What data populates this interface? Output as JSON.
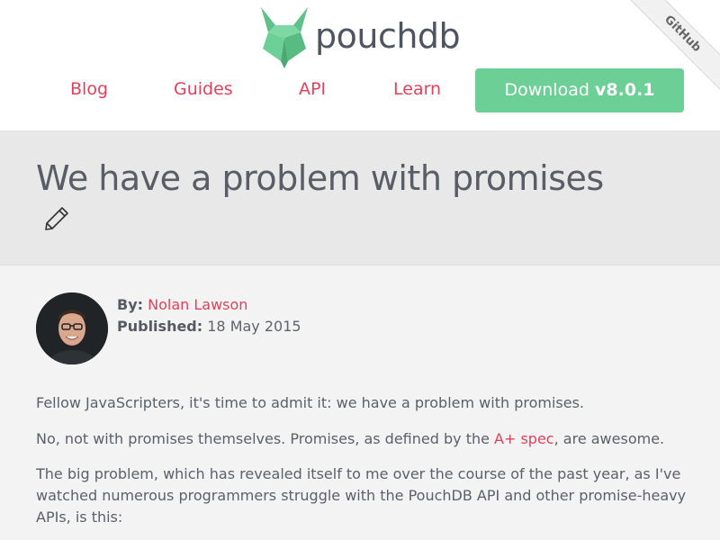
{
  "header": {
    "logo_text": "pouchdb",
    "nav": [
      "Blog",
      "Guides",
      "API",
      "Learn"
    ],
    "download": {
      "label": "Download",
      "version": "v8.0.1"
    },
    "ribbon": "GitHub"
  },
  "post": {
    "title": "We have a problem with promises",
    "by_label": "By:",
    "author": "Nolan Lawson",
    "published_label": "Published:",
    "date": "18 May 2015",
    "p1": "Fellow JavaScripters, it's time to admit it: we have a problem with promises.",
    "p2_before": "No, not with promises themselves. Promises, as defined by the ",
    "p2_link": "A+ spec",
    "p2_after": ", are awesome.",
    "p3": "The big problem, which has revealed itself to me over the course of the past year, as I've watched numerous programmers struggle with the PouchDB API and other promise-heavy APIs, is this:"
  },
  "colors": {
    "accent": "#e3415a",
    "download_bg": "#6ccf95",
    "logo_green": "#6ccf95",
    "title_band": "#e8e8e9"
  },
  "icons": [
    "pouchdb-logo-icon",
    "pencil-edit-icon"
  ]
}
